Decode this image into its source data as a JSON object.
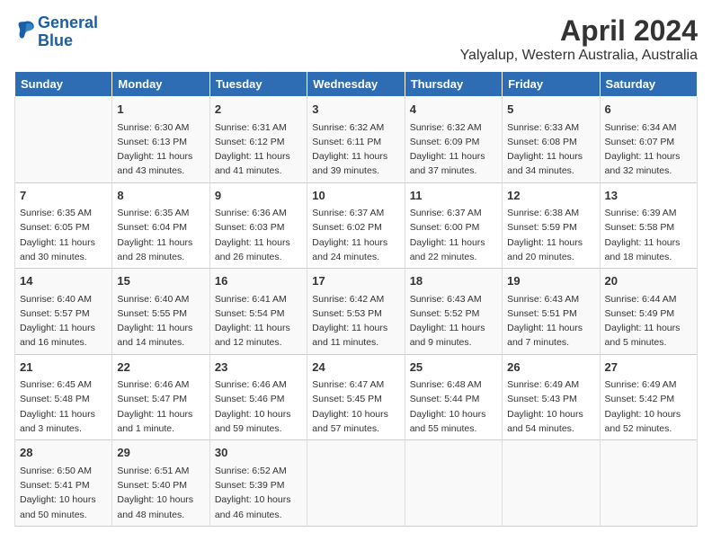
{
  "header": {
    "logo_line1": "General",
    "logo_line2": "Blue",
    "month_year": "April 2024",
    "location": "Yalyalup, Western Australia, Australia"
  },
  "columns": [
    "Sunday",
    "Monday",
    "Tuesday",
    "Wednesday",
    "Thursday",
    "Friday",
    "Saturday"
  ],
  "weeks": [
    [
      {
        "day": "",
        "info": ""
      },
      {
        "day": "1",
        "info": "Sunrise: 6:30 AM\nSunset: 6:13 PM\nDaylight: 11 hours\nand 43 minutes."
      },
      {
        "day": "2",
        "info": "Sunrise: 6:31 AM\nSunset: 6:12 PM\nDaylight: 11 hours\nand 41 minutes."
      },
      {
        "day": "3",
        "info": "Sunrise: 6:32 AM\nSunset: 6:11 PM\nDaylight: 11 hours\nand 39 minutes."
      },
      {
        "day": "4",
        "info": "Sunrise: 6:32 AM\nSunset: 6:09 PM\nDaylight: 11 hours\nand 37 minutes."
      },
      {
        "day": "5",
        "info": "Sunrise: 6:33 AM\nSunset: 6:08 PM\nDaylight: 11 hours\nand 34 minutes."
      },
      {
        "day": "6",
        "info": "Sunrise: 6:34 AM\nSunset: 6:07 PM\nDaylight: 11 hours\nand 32 minutes."
      }
    ],
    [
      {
        "day": "7",
        "info": "Sunrise: 6:35 AM\nSunset: 6:05 PM\nDaylight: 11 hours\nand 30 minutes."
      },
      {
        "day": "8",
        "info": "Sunrise: 6:35 AM\nSunset: 6:04 PM\nDaylight: 11 hours\nand 28 minutes."
      },
      {
        "day": "9",
        "info": "Sunrise: 6:36 AM\nSunset: 6:03 PM\nDaylight: 11 hours\nand 26 minutes."
      },
      {
        "day": "10",
        "info": "Sunrise: 6:37 AM\nSunset: 6:02 PM\nDaylight: 11 hours\nand 24 minutes."
      },
      {
        "day": "11",
        "info": "Sunrise: 6:37 AM\nSunset: 6:00 PM\nDaylight: 11 hours\nand 22 minutes."
      },
      {
        "day": "12",
        "info": "Sunrise: 6:38 AM\nSunset: 5:59 PM\nDaylight: 11 hours\nand 20 minutes."
      },
      {
        "day": "13",
        "info": "Sunrise: 6:39 AM\nSunset: 5:58 PM\nDaylight: 11 hours\nand 18 minutes."
      }
    ],
    [
      {
        "day": "14",
        "info": "Sunrise: 6:40 AM\nSunset: 5:57 PM\nDaylight: 11 hours\nand 16 minutes."
      },
      {
        "day": "15",
        "info": "Sunrise: 6:40 AM\nSunset: 5:55 PM\nDaylight: 11 hours\nand 14 minutes."
      },
      {
        "day": "16",
        "info": "Sunrise: 6:41 AM\nSunset: 5:54 PM\nDaylight: 11 hours\nand 12 minutes."
      },
      {
        "day": "17",
        "info": "Sunrise: 6:42 AM\nSunset: 5:53 PM\nDaylight: 11 hours\nand 11 minutes."
      },
      {
        "day": "18",
        "info": "Sunrise: 6:43 AM\nSunset: 5:52 PM\nDaylight: 11 hours\nand 9 minutes."
      },
      {
        "day": "19",
        "info": "Sunrise: 6:43 AM\nSunset: 5:51 PM\nDaylight: 11 hours\nand 7 minutes."
      },
      {
        "day": "20",
        "info": "Sunrise: 6:44 AM\nSunset: 5:49 PM\nDaylight: 11 hours\nand 5 minutes."
      }
    ],
    [
      {
        "day": "21",
        "info": "Sunrise: 6:45 AM\nSunset: 5:48 PM\nDaylight: 11 hours\nand 3 minutes."
      },
      {
        "day": "22",
        "info": "Sunrise: 6:46 AM\nSunset: 5:47 PM\nDaylight: 11 hours\nand 1 minute."
      },
      {
        "day": "23",
        "info": "Sunrise: 6:46 AM\nSunset: 5:46 PM\nDaylight: 10 hours\nand 59 minutes."
      },
      {
        "day": "24",
        "info": "Sunrise: 6:47 AM\nSunset: 5:45 PM\nDaylight: 10 hours\nand 57 minutes."
      },
      {
        "day": "25",
        "info": "Sunrise: 6:48 AM\nSunset: 5:44 PM\nDaylight: 10 hours\nand 55 minutes."
      },
      {
        "day": "26",
        "info": "Sunrise: 6:49 AM\nSunset: 5:43 PM\nDaylight: 10 hours\nand 54 minutes."
      },
      {
        "day": "27",
        "info": "Sunrise: 6:49 AM\nSunset: 5:42 PM\nDaylight: 10 hours\nand 52 minutes."
      }
    ],
    [
      {
        "day": "28",
        "info": "Sunrise: 6:50 AM\nSunset: 5:41 PM\nDaylight: 10 hours\nand 50 minutes."
      },
      {
        "day": "29",
        "info": "Sunrise: 6:51 AM\nSunset: 5:40 PM\nDaylight: 10 hours\nand 48 minutes."
      },
      {
        "day": "30",
        "info": "Sunrise: 6:52 AM\nSunset: 5:39 PM\nDaylight: 10 hours\nand 46 minutes."
      },
      {
        "day": "",
        "info": ""
      },
      {
        "day": "",
        "info": ""
      },
      {
        "day": "",
        "info": ""
      },
      {
        "day": "",
        "info": ""
      }
    ]
  ]
}
